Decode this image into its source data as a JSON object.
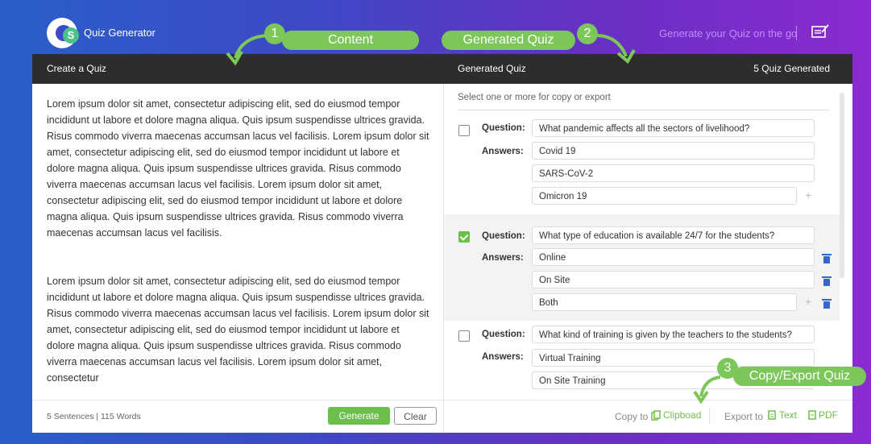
{
  "header": {
    "app_title": "Quiz Generator",
    "tagline": "Generate your Quiz on the go"
  },
  "callouts": [
    {
      "num": "1",
      "label": "Content"
    },
    {
      "num": "2",
      "label": "Generated Quiz"
    },
    {
      "num": "3",
      "label": "Copy/Export Quiz"
    }
  ],
  "left": {
    "bar_title": "Create a Quiz",
    "para1": "Lorem ipsum dolor sit amet, consectetur adipiscing elit, sed do eiusmod tempor incididunt ut labore et dolore magna aliqua. Quis ipsum suspendisse ultrices gravida. Risus commodo viverra maecenas accumsan lacus vel facilisis.  Lorem ipsum dolor sit amet, consectetur adipiscing elit, sed do eiusmod tempor incididunt ut labore et dolore magna aliqua. Quis ipsum suspendisse ultrices gravida. Risus commodo viverra maecenas accumsan lacus vel facilisis. Lorem ipsum dolor sit amet, consectetur adipiscing elit, sed do eiusmod tempor incididunt ut labore et dolore magna aliqua. Quis ipsum suspendisse ultrices gravida. Risus commodo viverra maecenas accumsan lacus vel facilisis.",
    "para2": "Lorem ipsum dolor sit amet, consectetur adipiscing elit, sed do eiusmod tempor incididunt ut labore et dolore magna aliqua. Quis ipsum suspendisse ultrices gravida. Risus commodo viverra maecenas accumsan lacus vel facilisis.  Lorem ipsum dolor sit amet, consectetur adipiscing elit, sed do eiusmod tempor incididunt ut labore et dolore magna aliqua. Quis ipsum suspendisse ultrices gravida. Risus commodo viverra maecenas accumsan lacus vel facilisis. Lorem ipsum dolor sit amet, consectetur",
    "stats": "5 Sentences  |  115 Words",
    "generate_label": "Generate",
    "clear_label": "Clear"
  },
  "right": {
    "bar_title": "Generated Quiz",
    "count": "5 Quiz Generated",
    "hint": "Select one or more for copy or export",
    "question_label": "Question:",
    "answers_label": "Answers:",
    "questions": [
      {
        "text": "What pandemic affects all the sectors of livelihood?",
        "checked": false,
        "answers": [
          "Covid 19",
          "SARS-CoV-2",
          "Omicron 19"
        ]
      },
      {
        "text": "What type of education is available 24/7 for the students?",
        "checked": true,
        "answers": [
          "Online",
          "On Site",
          "Both"
        ]
      },
      {
        "text": "What kind of training is given by the teachers to the students?",
        "checked": false,
        "answers": [
          "Virtual Training",
          "On Site Training"
        ]
      }
    ],
    "copy_to": "Copy to",
    "clipboard": "Clipboad",
    "export_to": "Export to",
    "text": "Text",
    "pdf": "PDF"
  },
  "colors": {
    "accent_green": "#7cc65a",
    "dark_bar": "#2d2d2d",
    "trash_blue": "#3566c8",
    "tagline": "#c18dff"
  }
}
